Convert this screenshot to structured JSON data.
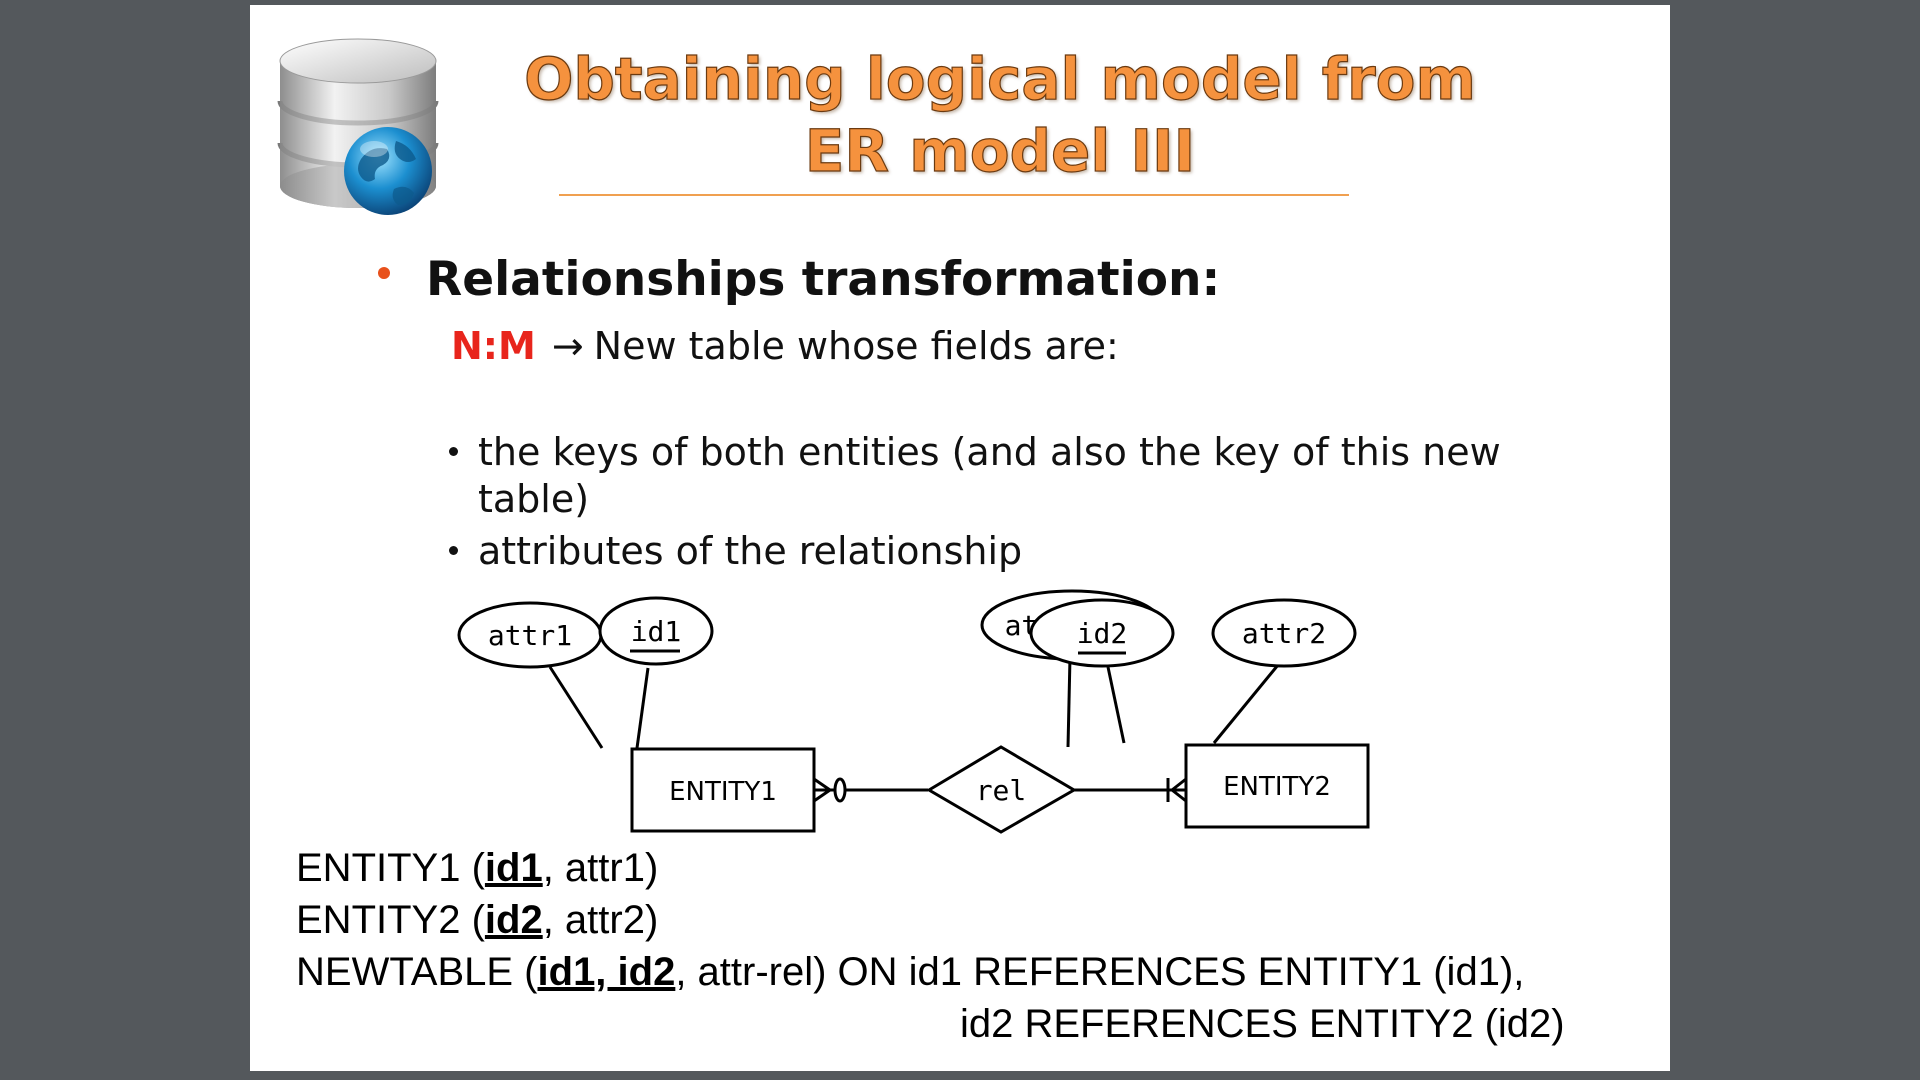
{
  "title": {
    "line1": "Obtaining logical model from",
    "line2": "ER model III"
  },
  "logo": {
    "icon": "database-globe-icon"
  },
  "heading": "Relationships transformation:",
  "rule": {
    "tag": "N:M",
    "arrow": "→",
    "text": "New table whose fields are:"
  },
  "bullets": [
    {
      "line1": "the keys of both entities (and also the key of this new",
      "line2": "table)"
    },
    {
      "line1": "attributes of the relationship"
    }
  ],
  "diagram": {
    "entity1": "ENTITY1",
    "entity2": "ENTITY2",
    "relationship": "rel",
    "attr1": "attr1",
    "id1": "id1",
    "attr_rel": "attr-rel",
    "id2": "id2",
    "attr2": "attr2"
  },
  "definitions": {
    "e1_open": "ENTITY1 (",
    "e1_key": "id1",
    "e1_rest": ", attr1)",
    "e2_open": "ENTITY2 (",
    "e2_key": "id2",
    "e2_rest": ", attr2)",
    "nt_open": "NEWTABLE (",
    "nt_key": "id1, id2",
    "nt_rest": ", attr-rel) ON id1 REFERENCES ENTITY1 (id1),",
    "nt_line2": "id2 REFERENCES ENTITY2 (id2)"
  },
  "colors": {
    "title": "#f5923e",
    "bullet": "#e8511c",
    "tag": "#e8251c",
    "page_bg": "#54585c"
  }
}
